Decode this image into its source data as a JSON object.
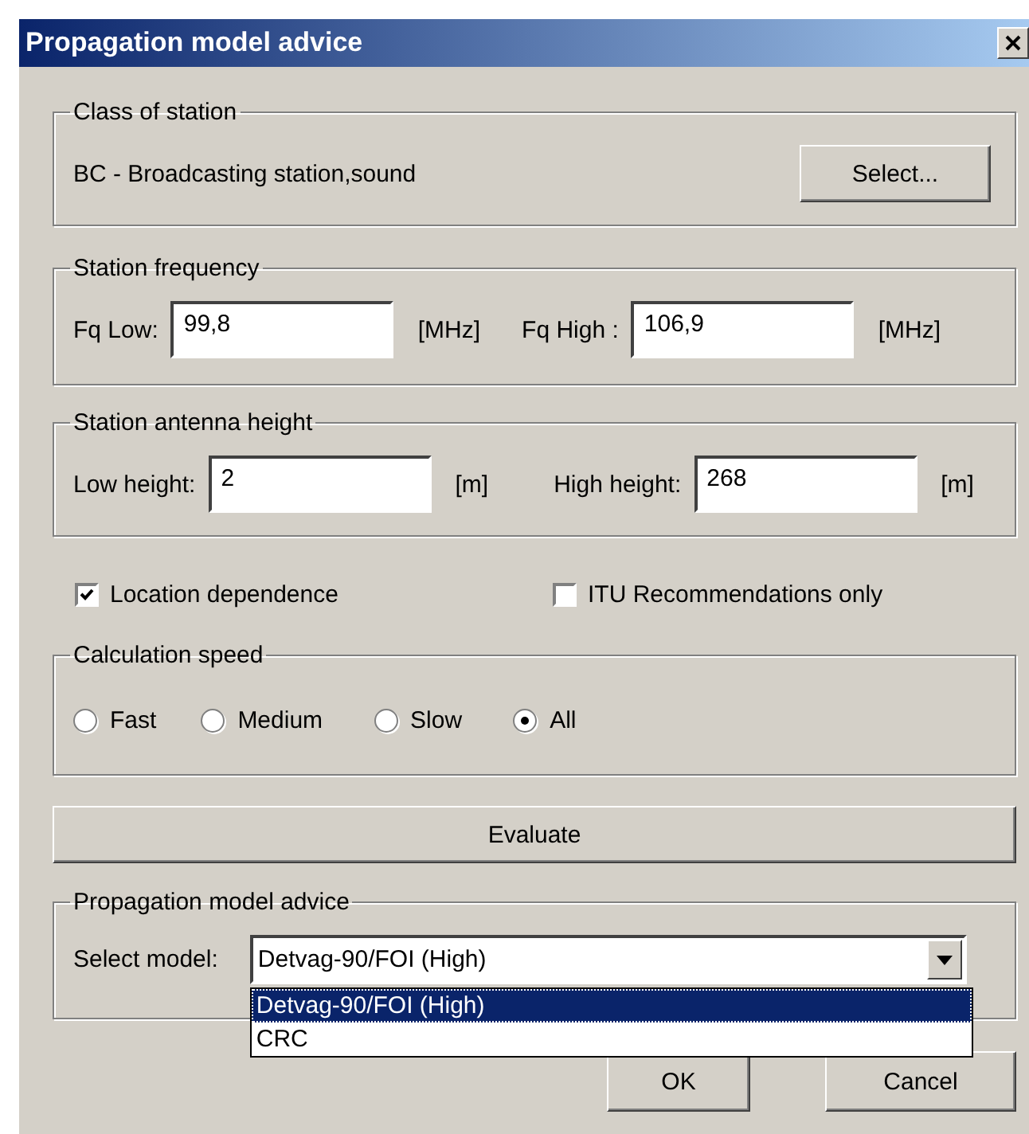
{
  "window": {
    "title": "Propagation model advice"
  },
  "class_of_station": {
    "title": "Class of station",
    "value": "BC - Broadcasting station,sound",
    "button": "Select..."
  },
  "station_frequency": {
    "title": "Station frequency",
    "fields": [
      {
        "label": "Fq Low:",
        "value": "99,8",
        "unit": "[MHz]"
      },
      {
        "label": "Fq High :",
        "value": "106,9",
        "unit": "[MHz]"
      }
    ]
  },
  "antenna_height": {
    "title": "Station antenna height",
    "fields": [
      {
        "label": "Low height:",
        "value": "2",
        "unit": "[m]"
      },
      {
        "label": "High height:",
        "value": "268",
        "unit": "[m]"
      }
    ]
  },
  "options": [
    {
      "label": "Location dependence",
      "checked": true
    },
    {
      "label": "ITU Recommendations only",
      "checked": false
    }
  ],
  "calculation_speed": {
    "title": "Calculation speed",
    "options": [
      {
        "label": "Fast",
        "selected": false
      },
      {
        "label": "Medium",
        "selected": false
      },
      {
        "label": "Slow",
        "selected": false
      },
      {
        "label": "All",
        "selected": true
      }
    ]
  },
  "evaluate_button": "Evaluate",
  "advice": {
    "title": "Propagation model advice",
    "label": "Select model:",
    "value": "Detvag-90/FOI (High)",
    "expanded": true,
    "options": [
      {
        "label": "Detvag-90/FOI (High)",
        "selected": true
      },
      {
        "label": "CRC",
        "selected": false
      }
    ]
  },
  "buttons": [
    "OK",
    "Cancel"
  ]
}
